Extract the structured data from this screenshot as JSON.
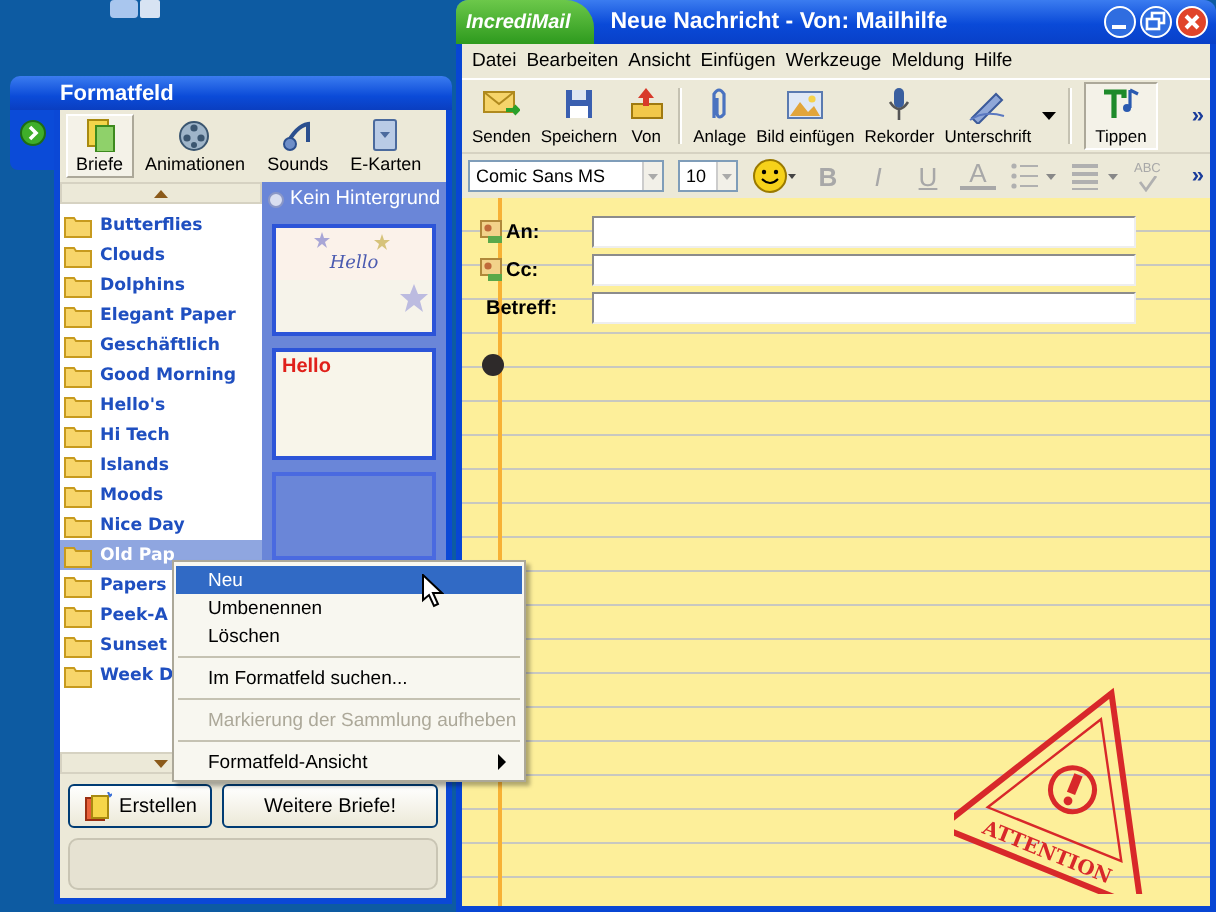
{
  "formatfeld": {
    "title": "Formatfeld",
    "tabs": [
      {
        "label": "Briefe",
        "selected": true
      },
      {
        "label": "Animationen",
        "selected": false
      },
      {
        "label": "Sounds",
        "selected": false
      },
      {
        "label": "E-Karten",
        "selected": false
      }
    ],
    "folders": [
      {
        "label": "Butterflies",
        "selected": false
      },
      {
        "label": "Clouds",
        "selected": false
      },
      {
        "label": "Dolphins",
        "selected": false
      },
      {
        "label": "Elegant Paper",
        "selected": false
      },
      {
        "label": "Geschäftlich",
        "selected": false
      },
      {
        "label": "Good Morning",
        "selected": false
      },
      {
        "label": "Hello's",
        "selected": false
      },
      {
        "label": "Hi Tech",
        "selected": false
      },
      {
        "label": "Islands",
        "selected": false
      },
      {
        "label": "Moods",
        "selected": false
      },
      {
        "label": "Nice Day",
        "selected": false
      },
      {
        "label": "Old Pap",
        "selected": true
      },
      {
        "label": "Papers",
        "selected": false
      },
      {
        "label": "Peek-A",
        "selected": false
      },
      {
        "label": "Sunset",
        "selected": false
      },
      {
        "label": "Week D",
        "selected": false
      }
    ],
    "thumbnails": {
      "header": "Kein Hintergrund",
      "items": [
        {
          "kind": "stars",
          "text": "Hello",
          "selected": false
        },
        {
          "kind": "plain",
          "text": "Hello",
          "selected": false
        },
        {
          "kind": "blank",
          "selected": true
        }
      ]
    },
    "buttons": [
      {
        "label": "Erstellen",
        "kind": "icon"
      },
      {
        "label": "Weitere Briefe!",
        "kind": "plain"
      }
    ]
  },
  "context_menu": {
    "items": [
      {
        "kind": "item",
        "label": "Neu",
        "selected": true,
        "disabled": false
      },
      {
        "kind": "item",
        "label": "Umbenennen",
        "selected": false,
        "disabled": false
      },
      {
        "kind": "item",
        "label": "Löschen",
        "selected": false,
        "disabled": false
      },
      {
        "kind": "separator"
      },
      {
        "kind": "item",
        "label": "Im Formatfeld suchen...",
        "selected": false,
        "disabled": false
      },
      {
        "kind": "separator"
      },
      {
        "kind": "item",
        "label": "Markierung der Sammlung aufheben",
        "selected": false,
        "disabled": true
      },
      {
        "kind": "separator"
      },
      {
        "kind": "submenu",
        "label": "Formatfeld-Ansicht",
        "selected": false,
        "disabled": false
      }
    ]
  },
  "mail_window": {
    "logo": "IncrediMail",
    "title": "Neue Nachricht - Von: Mailhilfe",
    "menu": [
      "Datei",
      "Bearbeiten",
      "Ansicht",
      "Einfügen",
      "Werkzeuge",
      "Meldung",
      "Hilfe"
    ],
    "toolbar": [
      {
        "kind": "button",
        "label": "Senden",
        "pressed": false
      },
      {
        "kind": "button",
        "label": "Speichern",
        "pressed": false
      },
      {
        "kind": "button",
        "label": "Von",
        "pressed": false
      },
      {
        "kind": "separator"
      },
      {
        "kind": "button",
        "label": "Anlage",
        "pressed": false
      },
      {
        "kind": "button",
        "label": "Bild einfügen",
        "pressed": false
      },
      {
        "kind": "button",
        "label": "Rekorder",
        "pressed": false
      },
      {
        "kind": "split",
        "label": "Unterschrift",
        "pressed": false
      },
      {
        "kind": "separator"
      },
      {
        "kind": "button",
        "label": "Tippen",
        "pressed": true
      },
      {
        "kind": "overflow",
        "label": "»"
      }
    ],
    "format_bar": [
      {
        "kind": "combo",
        "value": "Comic Sans MS"
      },
      {
        "kind": "combo",
        "value": "10"
      },
      {
        "kind": "emoji"
      },
      {
        "kind": "bold",
        "label": "B",
        "disabled": true
      },
      {
        "kind": "italic",
        "label": "I",
        "disabled": true
      },
      {
        "kind": "underline",
        "label": "U",
        "disabled": true
      },
      {
        "kind": "color",
        "label": "A",
        "disabled": true
      },
      {
        "kind": "list"
      },
      {
        "kind": "align"
      },
      {
        "kind": "spell",
        "label": "ABC"
      },
      {
        "kind": "overflow",
        "label": "»"
      }
    ],
    "fields": [
      {
        "label": "An:",
        "kind": "contact"
      },
      {
        "label": "Cc:",
        "kind": "contact"
      },
      {
        "label": "Betreff:",
        "kind": "plain"
      }
    ],
    "stamp": "ATTENTION"
  }
}
